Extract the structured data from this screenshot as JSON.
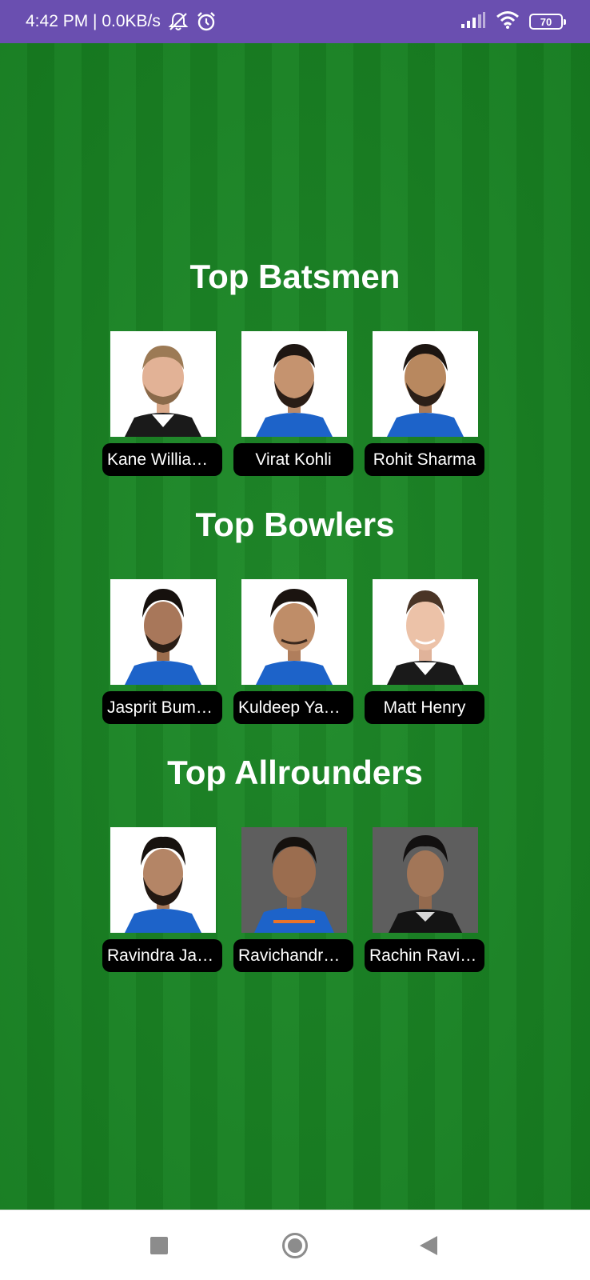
{
  "status_bar": {
    "time_speed": "4:42 PM | 0.0KB/s",
    "battery": "70",
    "icons": [
      "mute-icon",
      "alarm-icon",
      "signal-icon",
      "wifi-icon",
      "battery-icon"
    ]
  },
  "sections": [
    {
      "title": "Top Batsmen",
      "players": [
        {
          "name": "Kane Williamson",
          "jersey": "new-zealand-black"
        },
        {
          "name": "Virat Kohli",
          "jersey": "india-blue"
        },
        {
          "name": "Rohit Sharma",
          "jersey": "india-blue"
        }
      ]
    },
    {
      "title": "Top Bowlers",
      "players": [
        {
          "name": "Jasprit Bumrah",
          "jersey": "india-blue"
        },
        {
          "name": "Kuldeep Yadav",
          "jersey": "india-blue"
        },
        {
          "name": "Matt Henry",
          "jersey": "new-zealand-black"
        }
      ]
    },
    {
      "title": "Top Allrounders",
      "players": [
        {
          "name": "Ravindra Jadeja",
          "jersey": "india-blue"
        },
        {
          "name": "Ravichandran Ashwin",
          "jersey": "india-blue"
        },
        {
          "name": "Rachin Ravindra",
          "jersey": "new-zealand-black"
        }
      ]
    }
  ],
  "nav_bar": {
    "icons": [
      "recents-square-icon",
      "home-circle-icon",
      "back-triangle-icon"
    ]
  },
  "colors": {
    "status_bar": "#6a4fb0",
    "field_light": "#1d8a28",
    "field_dark": "#178021",
    "label_bg": "#000000",
    "title_text": "#ffffff"
  }
}
